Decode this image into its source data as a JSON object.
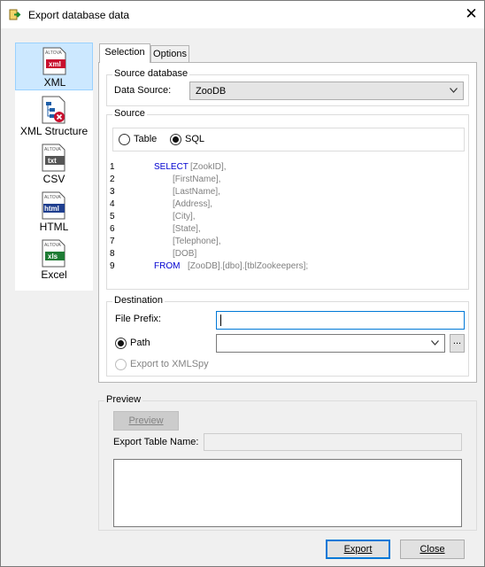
{
  "window": {
    "title": "Export database data",
    "close_glyph": "✕"
  },
  "nav": {
    "items": [
      {
        "label": "XML",
        "icon": "xml-file-icon",
        "badge": "xml",
        "selected": true
      },
      {
        "label": "XML Structure",
        "icon": "xml-structure-icon",
        "selected": false
      },
      {
        "label": "CSV",
        "icon": "csv-file-icon",
        "badge": "txt",
        "selected": false
      },
      {
        "label": "HTML",
        "icon": "html-file-icon",
        "badge": "html",
        "selected": false
      },
      {
        "label": "Excel",
        "icon": "excel-file-icon",
        "badge": "xls",
        "selected": false
      }
    ],
    "brand": "ALTOVA"
  },
  "tabs": [
    {
      "label": "Selection",
      "active": true
    },
    {
      "label": "Options",
      "active": false
    }
  ],
  "source_database": {
    "group_label": "Source database",
    "data_source_label": "Data Source:",
    "data_source_value": "ZooDB"
  },
  "source": {
    "group_label": "Source",
    "table_label": "Table",
    "sql_label": "SQL",
    "selected": "SQL",
    "sql_lines": [
      {
        "n": "1",
        "kw": "SELECT",
        "text": "[ZookID],"
      },
      {
        "n": "2",
        "kw": "",
        "text": "[FirstName],"
      },
      {
        "n": "3",
        "kw": "",
        "text": "[LastName],"
      },
      {
        "n": "4",
        "kw": "",
        "text": "[Address],"
      },
      {
        "n": "5",
        "kw": "",
        "text": "[City],"
      },
      {
        "n": "6",
        "kw": "",
        "text": "[State],"
      },
      {
        "n": "7",
        "kw": "",
        "text": "[Telephone],"
      },
      {
        "n": "8",
        "kw": "",
        "text": "[DOB]"
      },
      {
        "n": "9",
        "kw": "FROM",
        "text": "[ZooDB].[dbo].[tblZookeepers];"
      }
    ]
  },
  "destination": {
    "group_label": "Destination",
    "file_prefix_label": "File Prefix:",
    "file_prefix_value": "",
    "path_label": "Path",
    "path_value": "",
    "browse_label": "...",
    "export_xmlspy_label": "Export to XMLSpy"
  },
  "preview": {
    "group_label": "Preview",
    "button_label": "Preview",
    "export_table_name_label": "Export Table Name:",
    "export_table_name_value": ""
  },
  "footer": {
    "export_label": "Export",
    "close_label": "Close"
  },
  "colors": {
    "selected_bg": "#cce8ff",
    "keyword": "#0000d0",
    "identifier": "#808080",
    "focus": "#0078d7"
  }
}
